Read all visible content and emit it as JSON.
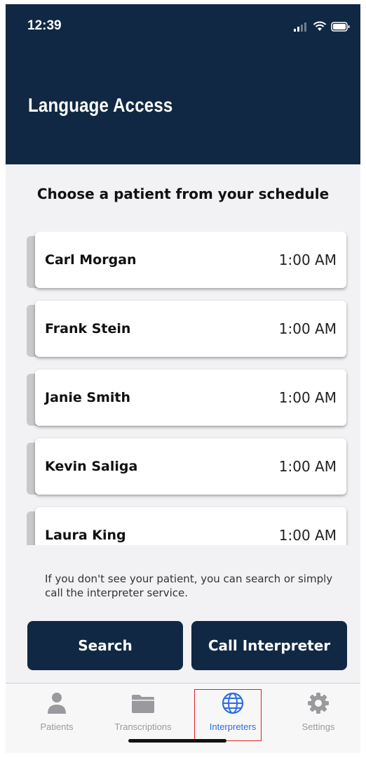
{
  "status_bar": {
    "time": "12:39"
  },
  "header": {
    "title": "Language Access"
  },
  "prompt": "Choose a patient from your schedule",
  "patients": [
    {
      "name": "Carl Morgan",
      "time": "1:00 AM"
    },
    {
      "name": "Frank Stein",
      "time": "1:00 AM"
    },
    {
      "name": "Janie Smith",
      "time": "1:00 AM"
    },
    {
      "name": "Kevin Saliga",
      "time": "1:00 AM"
    },
    {
      "name": "Laura King",
      "time": "1:00 AM"
    }
  ],
  "hint": "If you don't see your patient, you can search or simply call the interpreter service.",
  "buttons": {
    "search": "Search",
    "call": "Call Interpreter"
  },
  "tabbar": {
    "items": [
      {
        "label": "Patients",
        "icon": "person-icon"
      },
      {
        "label": "Transcriptions",
        "icon": "folder-icon"
      },
      {
        "label": "Interpreters",
        "icon": "globe-icon",
        "active": true
      },
      {
        "label": "Settings",
        "icon": "gear-icon"
      }
    ]
  },
  "colors": {
    "brand": "#102844",
    "active_tab": "#2f6de0",
    "focus_outline": "#e32121"
  }
}
